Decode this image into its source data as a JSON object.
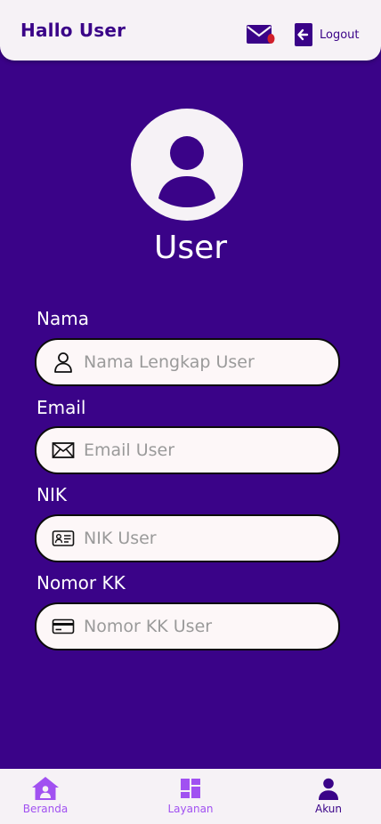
{
  "header": {
    "greeting": "Hallo User",
    "mail_icon": "mail-icon",
    "logout_label": "Logout",
    "logout_icon": "arrow-left-box-icon"
  },
  "profile": {
    "avatar_icon": "user-avatar-icon",
    "name": "User"
  },
  "form": {
    "fields": [
      {
        "label": "Nama",
        "placeholder": "Nama Lengkap User",
        "icon": "person-icon"
      },
      {
        "label": "Email",
        "placeholder": "Email User",
        "icon": "envelope-icon"
      },
      {
        "label": "NIK",
        "placeholder": "NIK User",
        "icon": "id-card-icon"
      },
      {
        "label": "Nomor KK",
        "placeholder": "Nomor KK User",
        "icon": "credit-card-icon"
      }
    ]
  },
  "nav": {
    "items": [
      {
        "label": "Beranda",
        "icon": "home-icon",
        "active": false
      },
      {
        "label": "Layanan",
        "icon": "dashboard-icon",
        "active": false
      },
      {
        "label": "Akun",
        "icon": "person-icon",
        "active": true
      }
    ]
  },
  "colors": {
    "primary": "#3a0388",
    "accent": "#a151f1",
    "surface": "#f6f2f6",
    "badge": "#d11f2a"
  }
}
